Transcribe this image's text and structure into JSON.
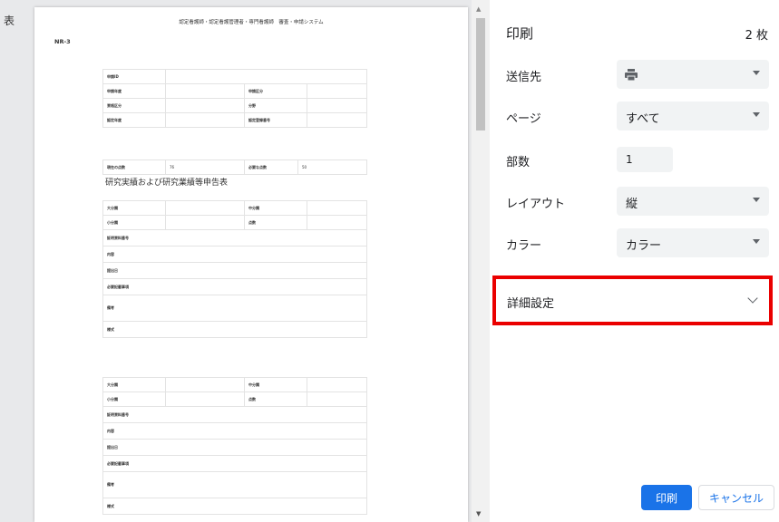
{
  "preview": {
    "edge_char": "表",
    "doc_header": "認定看護師・認定看護管理者・専門看護師　審査・申請システム",
    "doc_code": "NR-3",
    "form1": {
      "application_id": "申請ID",
      "application_year": "申請年度",
      "application_type": "申請区分",
      "qualification_type": "資格区分",
      "field": "分野",
      "cert_year": "認定年度",
      "cert_number": "認定登録番号"
    },
    "points": {
      "current_label": "現在の点数",
      "current_value": "76",
      "required_label": "必要な点数",
      "required_value": "50"
    },
    "section_title": "研究実績および研究業績等申告表",
    "record": {
      "major": "大分類",
      "middle": "中分類",
      "minor": "小分類",
      "points": "点数",
      "evidence_no": "証明資料番号",
      "content": "内容",
      "date": "提出日",
      "required_items": "必要記載事項",
      "remarks": "備考",
      "format": "様式"
    }
  },
  "panel": {
    "title": "印刷",
    "sheet_count": "2 枚",
    "destination": {
      "label": "送信先",
      "icon": "printer-icon",
      "value": ""
    },
    "pages": {
      "label": "ページ",
      "value": "すべて"
    },
    "copies": {
      "label": "部数",
      "value": "1"
    },
    "layout": {
      "label": "レイアウト",
      "value": "縦"
    },
    "color": {
      "label": "カラー",
      "value": "カラー"
    },
    "advanced": {
      "label": "詳細設定"
    },
    "print_button": "印刷",
    "cancel_button": "キャンセル"
  },
  "colors": {
    "primary": "#1a73e8",
    "highlight": "#ea0000",
    "select_bg": "#f1f3f4"
  }
}
